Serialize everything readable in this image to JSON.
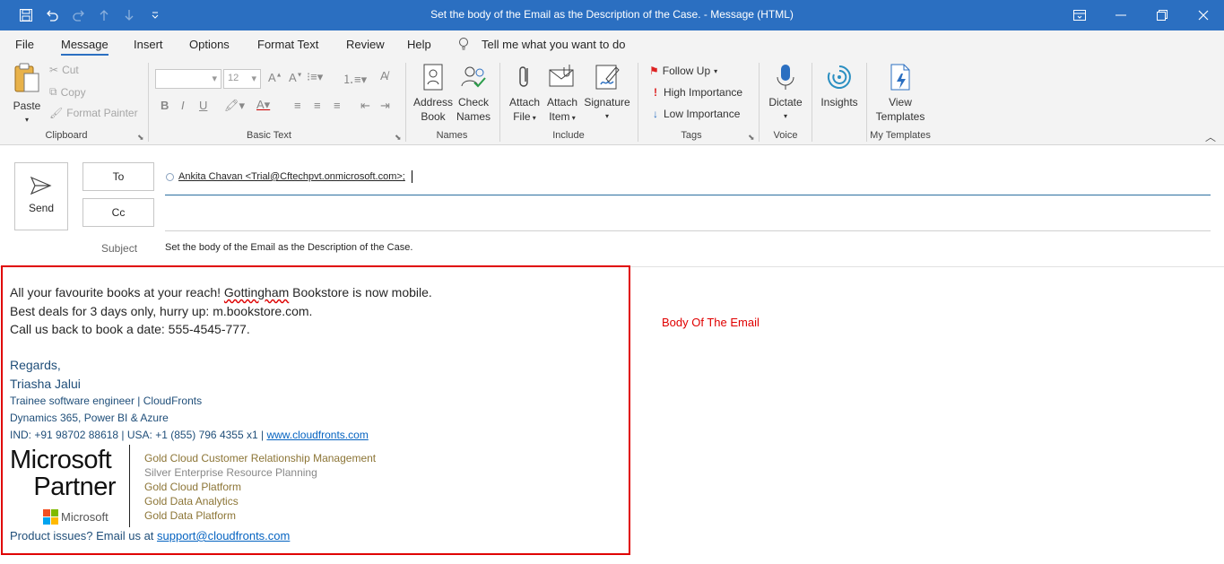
{
  "titlebar": {
    "title": "Set the body of the Email as the Description of the Case.  -  Message (HTML)"
  },
  "menu": [
    "File",
    "Message",
    "Insert",
    "Options",
    "Format Text",
    "Review",
    "Help"
  ],
  "tell_me": "Tell me what you want to do",
  "ribbon": {
    "clipboard": {
      "paste": "Paste",
      "cut": "Cut",
      "copy": "Copy",
      "format_painter": "Format Painter",
      "label": "Clipboard"
    },
    "basic_text": {
      "font_size": "12",
      "label": "Basic Text"
    },
    "names": {
      "address_book": [
        "Address",
        "Book"
      ],
      "check_names": [
        "Check",
        "Names"
      ],
      "label": "Names"
    },
    "include": {
      "attach_file": [
        "Attach",
        "File"
      ],
      "attach_item": [
        "Attach",
        "Item"
      ],
      "signature": "Signature",
      "label": "Include"
    },
    "tags": {
      "follow_up": "Follow Up",
      "high": "High Importance",
      "low": "Low Importance",
      "label": "Tags"
    },
    "voice": {
      "dictate": "Dictate",
      "label": "Voice"
    },
    "insights": {
      "label": "Insights"
    },
    "templates": {
      "view": [
        "View",
        "Templates"
      ],
      "label": "My Templates"
    }
  },
  "compose": {
    "send": "Send",
    "to_label": "To",
    "cc_label": "Cc",
    "subject_label": "Subject",
    "to_value": "Ankita Chavan <Trial@Cftechpvt.onmicrosoft.com>;",
    "subject_value": "Set the body of the Email as the Description of the Case."
  },
  "body": {
    "line1_pre": "All your favourite books at your reach! ",
    "line1_misspelled": "Gottingham",
    "line1_post": " Bookstore is now mobile.",
    "line2": "Best deals for 3 days only, hurry up: m.bookstore.com.",
    "line3": "Call us back to book a date: 555-4545-777.",
    "regards": "Regards,",
    "name": "Triasha Jalui",
    "role": "Trainee software engineer | CloudFronts",
    "skills": "Dynamics 365, Power BI & Azure",
    "phone": "IND: +91 98702 88618 | USA: +1 (855) 796 4355 x1 | ",
    "website": "www.cloudfronts.com",
    "partner_word1": "Microsoft",
    "partner_word2": "Partner",
    "ms_small": "Microsoft",
    "competencies": [
      "Gold Cloud Customer Relationship Management",
      "Silver Enterprise Resource Planning",
      "Gold Cloud Platform",
      "Gold Data Analytics",
      "Gold Data Platform"
    ],
    "support_pre": "Product issues? Email us at ",
    "support_link": "support@cloudfronts.com"
  },
  "annotation": "Body Of The Email",
  "colors": {
    "accent": "#2b6fc1",
    "highlight_box": "#e00000",
    "annotation": "#e00000"
  }
}
